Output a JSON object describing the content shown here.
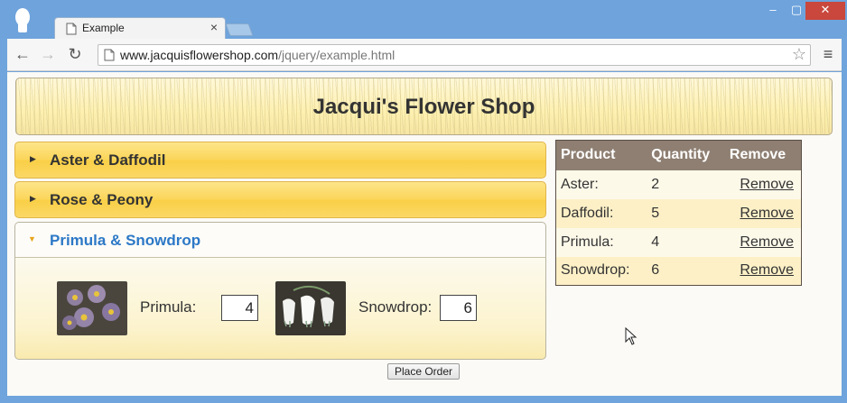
{
  "browser": {
    "tab_title": "Example",
    "tab_close": "×",
    "url_host": "www.jacquisflowershop.com",
    "url_path": "/jquery/example.html",
    "window_controls": {
      "minimize": "–",
      "maximize": "▢",
      "close": "✕"
    },
    "nav": {
      "back": "←",
      "forward": "→",
      "reload": "↻",
      "star": "☆",
      "menu": "≡"
    }
  },
  "page": {
    "title": "Jacqui's Flower Shop",
    "accordion": [
      {
        "label": "Aster & Daffodil",
        "expanded": false
      },
      {
        "label": "Rose & Peony",
        "expanded": false
      },
      {
        "label": "Primula & Snowdrop",
        "expanded": true
      }
    ],
    "products": [
      {
        "name": "Primula:",
        "quantity": "4"
      },
      {
        "name": "Snowdrop:",
        "quantity": "6"
      }
    ],
    "place_order_label": "Place Order",
    "basket": {
      "headers": [
        "Product",
        "Quantity",
        "Remove"
      ],
      "rows": [
        {
          "product": "Aster:",
          "quantity": "2",
          "remove": "Remove"
        },
        {
          "product": "Daffodil:",
          "quantity": "5",
          "remove": "Remove"
        },
        {
          "product": "Primula:",
          "quantity": "4",
          "remove": "Remove"
        },
        {
          "product": "Snowdrop:",
          "quantity": "6",
          "remove": "Remove"
        }
      ]
    }
  },
  "colors": {
    "accordion_header": "#fbd558",
    "active_label": "#2c78c7",
    "table_header": "#8e7f72",
    "chrome_frame": "#6ea3dc"
  }
}
